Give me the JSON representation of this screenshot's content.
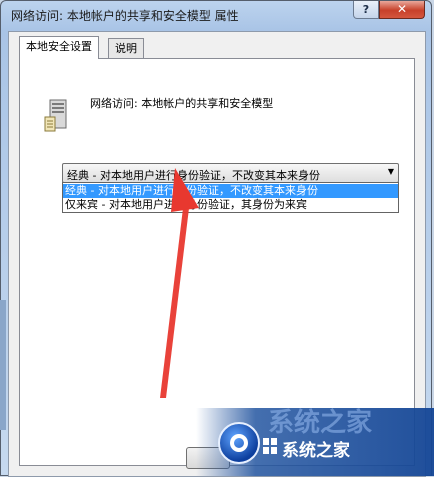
{
  "window": {
    "title": "网络访问: 本地帐户的共享和安全模型 属性",
    "help_glyph": "?",
    "close_glyph": "✕"
  },
  "tabs": [
    {
      "label": "本地安全设置",
      "active": true
    },
    {
      "label": "说明",
      "active": false
    }
  ],
  "policy": {
    "icon": "server-computer-icon",
    "title": "网络访问: 本地帐户的共享和安全模型"
  },
  "dropdown": {
    "selected_value": "经典 - 对本地用户进行身份验证，不改变其本来身份",
    "options": [
      "经典 - 对本地用户进行身份验证，不改变其本来身份",
      "仅来宾 - 对本地用户进行身份验证，其身份为来宾"
    ],
    "highlighted_index": 0
  },
  "annotation": {
    "arrow_color": "#e8382f"
  },
  "watermark": {
    "logo_icon": "xitong-zhijia-logo",
    "text": "系统之家",
    "faded_text": "系统之家"
  }
}
